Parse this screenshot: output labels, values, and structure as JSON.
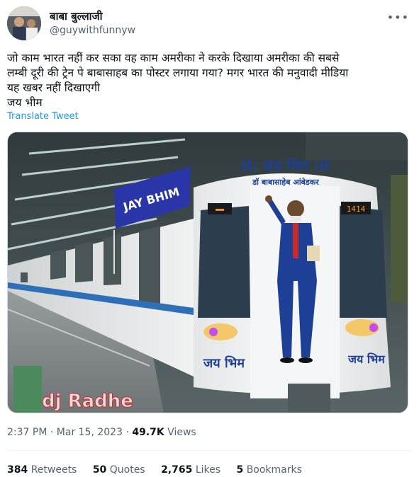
{
  "author": {
    "display_name": "बाबा बुल्लाजी",
    "handle": "@guywithfunnyw"
  },
  "tweet": {
    "text": "जो काम भारत नहीं कर सका वह काम अमरीका ने करके दिखाया अमरीका की सबसे\nलम्बी दूरी की ट्रेन पे बाबासाहब का पोस्टर लगाया गया? मगर भारत की मनुवादी मीडिया\nयह खबर नहीं दिखाएगी\nजय भीम",
    "translate_label": "Translate Tweet"
  },
  "image": {
    "flag_text": "JAY BHIM",
    "banner_top": "II: जय भिम :II",
    "banner_sub": "डॉ बाबासाहेब आंबेडकर",
    "left_lower": "जय भिम",
    "center_lower": "जय भिम",
    "right_lower": "जय भिम",
    "display_right": "1414",
    "watermark": "dj Radhe"
  },
  "meta": {
    "time": "2:37 PM",
    "separator": "·",
    "date": "Mar 15, 2023",
    "views_count": "49.7K",
    "views_label": "Views"
  },
  "stats": {
    "retweets_count": "384",
    "retweets_label": "Retweets",
    "quotes_count": "50",
    "quotes_label": "Quotes",
    "likes_count": "2,765",
    "likes_label": "Likes",
    "bookmarks_count": "5",
    "bookmarks_label": "Bookmarks"
  },
  "colors": {
    "link": "#1d9bf0",
    "secondary_text": "#536471",
    "primary_text": "#0f1419"
  },
  "icons": {
    "more": "more-options-icon"
  }
}
